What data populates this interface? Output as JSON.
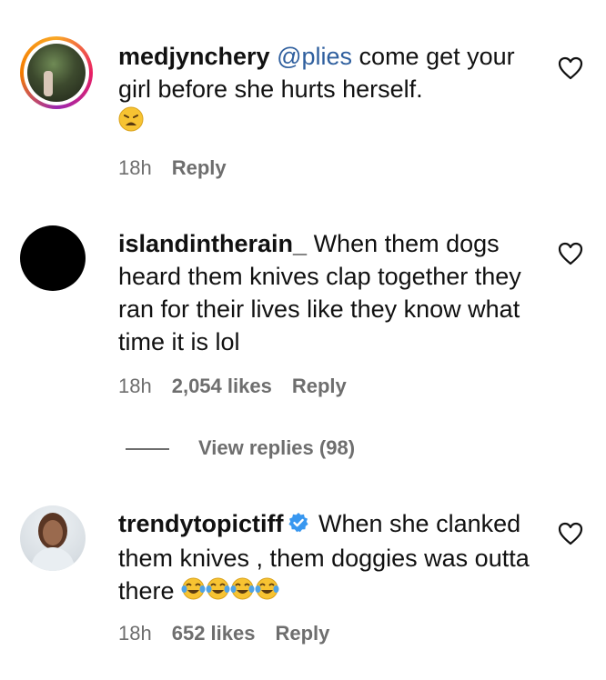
{
  "comments": [
    {
      "username": "medjynchery",
      "mention": "@plies",
      "text": " come get your girl before she hurts herself.",
      "emoji_icons": [
        "weary-face-icon"
      ],
      "time": "18h",
      "reply": "Reply",
      "avatar_style": "story-ring"
    },
    {
      "username": "islandintherain_",
      "text": " When them dogs heard them knives clap together they ran for their lives like they know what time it is lol",
      "time": "18h",
      "likes": "2,054 likes",
      "reply": "Reply",
      "view_replies": "View replies (98)"
    },
    {
      "username": "trendytopictiff",
      "verified": true,
      "text": " When she clanked them knives , them doggies was outta there ",
      "emoji_icons": [
        "tears-of-joy-icon",
        "tears-of-joy-icon",
        "tears-of-joy-icon",
        "tears-of-joy-icon"
      ],
      "time": "18h",
      "likes": "652 likes",
      "reply": "Reply"
    }
  ],
  "colors": {
    "mention": "#2f5f9e",
    "meta": "#6e6e6e",
    "verified": "#3897f0"
  }
}
